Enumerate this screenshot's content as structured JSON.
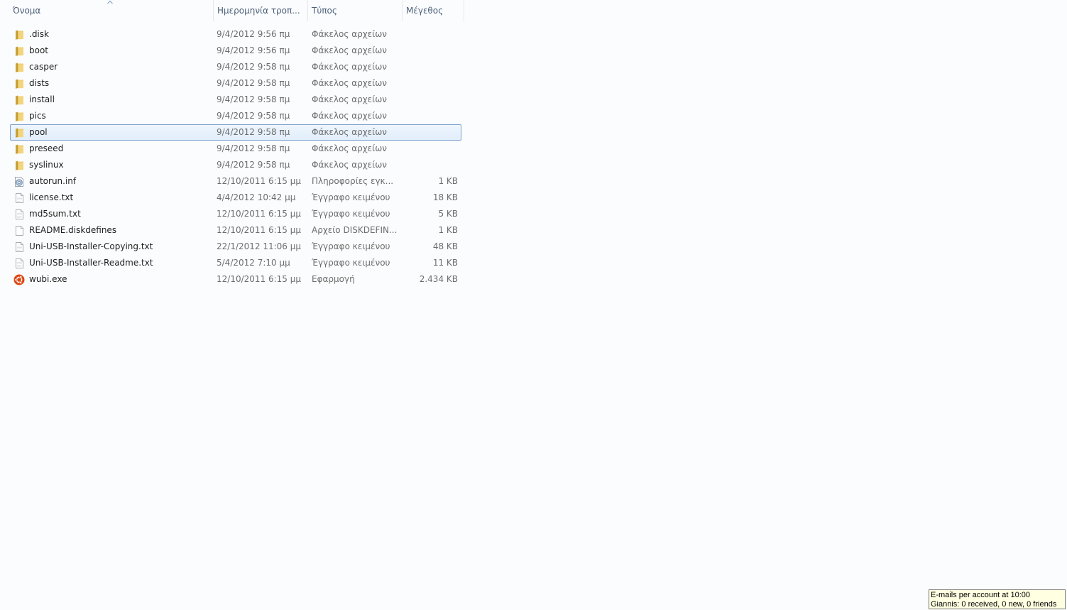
{
  "columns": {
    "name": "Όνομα",
    "date": "Ημερομηνία τροπ...",
    "type": "Τύπος",
    "size": "Μέγεθος"
  },
  "files": [
    {
      "name": ".disk",
      "date": "9/4/2012 9:56 πμ",
      "type": "Φάκελος αρχείων",
      "size": "",
      "icon": "folder-icon"
    },
    {
      "name": "boot",
      "date": "9/4/2012 9:56 πμ",
      "type": "Φάκελος αρχείων",
      "size": "",
      "icon": "folder-icon"
    },
    {
      "name": "casper",
      "date": "9/4/2012 9:58 πμ",
      "type": "Φάκελος αρχείων",
      "size": "",
      "icon": "folder-icon"
    },
    {
      "name": "dists",
      "date": "9/4/2012 9:58 πμ",
      "type": "Φάκελος αρχείων",
      "size": "",
      "icon": "folder-icon"
    },
    {
      "name": "install",
      "date": "9/4/2012 9:58 πμ",
      "type": "Φάκελος αρχείων",
      "size": "",
      "icon": "folder-icon"
    },
    {
      "name": "pics",
      "date": "9/4/2012 9:58 πμ",
      "type": "Φάκελος αρχείων",
      "size": "",
      "icon": "folder-icon"
    },
    {
      "name": "pool",
      "date": "9/4/2012 9:58 πμ",
      "type": "Φάκελος αρχείων",
      "size": "",
      "icon": "folder-icon",
      "selected": true
    },
    {
      "name": "preseed",
      "date": "9/4/2012 9:58 πμ",
      "type": "Φάκελος αρχείων",
      "size": "",
      "icon": "folder-icon"
    },
    {
      "name": "syslinux",
      "date": "9/4/2012 9:58 πμ",
      "type": "Φάκελος αρχείων",
      "size": "",
      "icon": "folder-icon"
    },
    {
      "name": "autorun.inf",
      "date": "12/10/2011 6:15 μμ",
      "type": "Πληροφορίες εγκ...",
      "size": "1 KB",
      "icon": "settings-file-icon"
    },
    {
      "name": "license.txt",
      "date": "4/4/2012 10:42 μμ",
      "type": "Έγγραφο κειμένου",
      "size": "18 KB",
      "icon": "text-file-icon"
    },
    {
      "name": "md5sum.txt",
      "date": "12/10/2011 6:15 μμ",
      "type": "Έγγραφο κειμένου",
      "size": "5 KB",
      "icon": "text-file-icon"
    },
    {
      "name": "README.diskdefines",
      "date": "12/10/2011 6:15 μμ",
      "type": "Αρχείο DISKDEFIN...",
      "size": "1 KB",
      "icon": "blank-file-icon"
    },
    {
      "name": "Uni-USB-Installer-Copying.txt",
      "date": "22/1/2012 11:06 μμ",
      "type": "Έγγραφο κειμένου",
      "size": "48 KB",
      "icon": "text-file-icon"
    },
    {
      "name": "Uni-USB-Installer-Readme.txt",
      "date": "5/4/2012 7:10 μμ",
      "type": "Έγγραφο κειμένου",
      "size": "11 KB",
      "icon": "text-file-icon"
    },
    {
      "name": "wubi.exe",
      "date": "12/10/2011 6:15 μμ",
      "type": "Εφαρμογή",
      "size": "2.434 KB",
      "icon": "ubuntu-logo-icon"
    }
  ],
  "tooltip": {
    "line1": "E-mails per account at 10:00",
    "line2": "Giannis: 0 received, 0 new, 0 friends"
  },
  "colors": {
    "header_text": "#4c607a",
    "selection_border": "#7da2ce",
    "selection_fill": "#e8f1fc",
    "folder": "#e8c35a",
    "ubuntu": "#dd4814",
    "tooltip_bg": "#ffffe1"
  }
}
